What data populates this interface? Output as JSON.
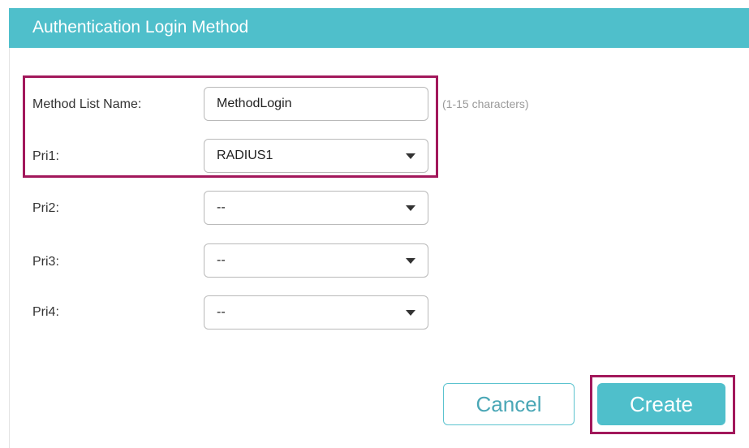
{
  "dialog": {
    "title": "Authentication Login Method"
  },
  "form": {
    "method_list_name": {
      "label": "Method List Name:",
      "value": "MethodLogin",
      "hint": "(1-15 characters)"
    },
    "pri1": {
      "label": "Pri1:",
      "value": "RADIUS1"
    },
    "pri2": {
      "label": "Pri2:",
      "value": "--"
    },
    "pri3": {
      "label": "Pri3:",
      "value": "--"
    },
    "pri4": {
      "label": "Pri4:",
      "value": "--"
    }
  },
  "buttons": {
    "cancel_label": "Cancel",
    "create_label": "Create"
  },
  "icons": {
    "dropdown": "caret-down-icon"
  },
  "colors": {
    "accent": "#4fbfcb",
    "highlight": "#a2185b"
  }
}
